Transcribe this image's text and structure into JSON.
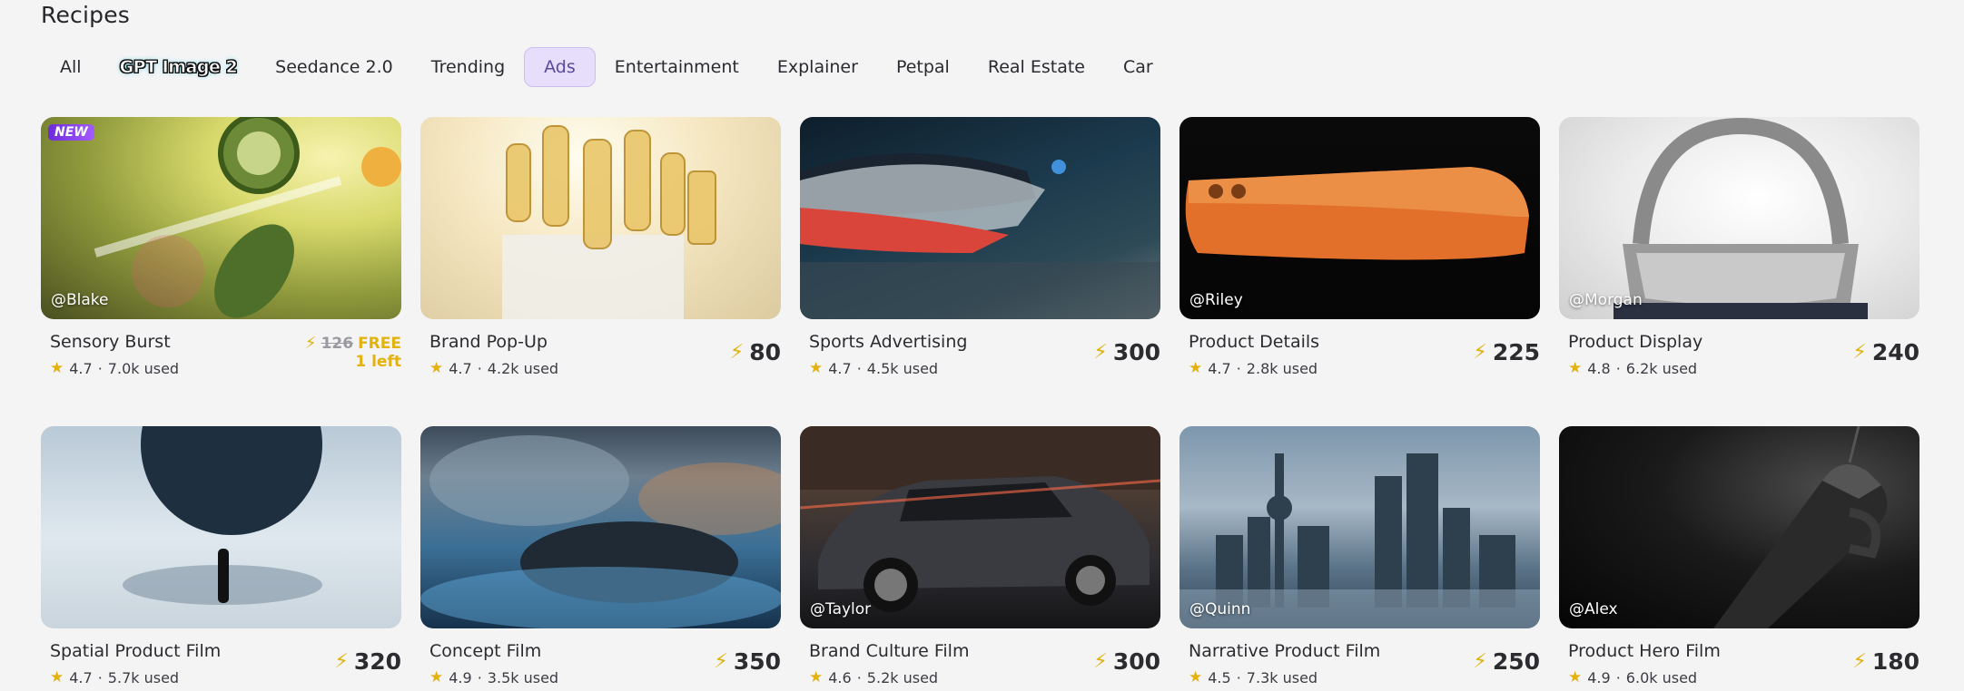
{
  "page": {
    "title": "Recipes"
  },
  "tabs": [
    {
      "label": "All"
    },
    {
      "label": "GPT Image 2"
    },
    {
      "label": "Seedance 2.0"
    },
    {
      "label": "Trending"
    },
    {
      "label": "Ads"
    },
    {
      "label": "Entertainment"
    },
    {
      "label": "Explainer"
    },
    {
      "label": "Petpal"
    },
    {
      "label": "Real Estate"
    },
    {
      "label": "Car"
    }
  ],
  "active_tab": "Ads",
  "colors": {
    "accent": "#e6defa",
    "star": "#e3b20f",
    "bolt": "#e0b20c"
  },
  "cards": [
    {
      "name": "Sensory Burst",
      "author": "@Blake",
      "rating": "4.7",
      "used": "7.0k used",
      "badge": "NEW",
      "price_old": "126",
      "price_free": "FREE",
      "remaining": "1 left"
    },
    {
      "name": "Brand Pop-Up",
      "author": "",
      "rating": "4.7",
      "used": "4.2k used",
      "price": "80"
    },
    {
      "name": "Sports Advertising",
      "author": "",
      "rating": "4.7",
      "used": "4.5k used",
      "price": "300"
    },
    {
      "name": "Product Details",
      "author": "@Riley",
      "rating": "4.7",
      "used": "2.8k used",
      "price": "225"
    },
    {
      "name": "Product Display",
      "author": "@Morgan",
      "rating": "4.8",
      "used": "6.2k used",
      "price": "240"
    },
    {
      "name": "Spatial Product Film",
      "author": "",
      "rating": "4.7",
      "used": "5.7k used",
      "price": "320"
    },
    {
      "name": "Concept Film",
      "author": "",
      "rating": "4.9",
      "used": "3.5k used",
      "price": "350"
    },
    {
      "name": "Brand Culture Film",
      "author": "@Taylor",
      "rating": "4.6",
      "used": "5.2k used",
      "price": "300"
    },
    {
      "name": "Narrative Product Film",
      "author": "@Quinn",
      "rating": "4.5",
      "used": "7.3k used",
      "price": "250"
    },
    {
      "name": "Product Hero Film",
      "author": "@Alex",
      "rating": "4.9",
      "used": "6.0k used",
      "price": "180"
    }
  ],
  "icons": {
    "star": "star-icon",
    "bolt": "lightning-bolt-icon"
  }
}
